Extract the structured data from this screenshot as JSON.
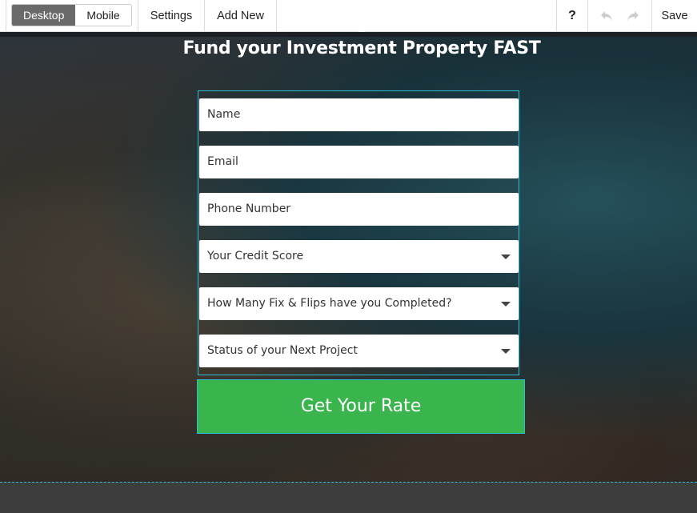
{
  "toolbar": {
    "view_modes": [
      {
        "label": "Desktop",
        "active": true
      },
      {
        "label": "Mobile",
        "active": false
      }
    ],
    "settings_label": "Settings",
    "add_new_label": "Add New",
    "help_label": "?",
    "undo_icon": "undo-icon",
    "redo_icon": "redo-icon",
    "save_label": "Save"
  },
  "page": {
    "headline": "Fund your Investment Property FAST",
    "form": {
      "fields": [
        {
          "type": "text",
          "placeholder": "Name"
        },
        {
          "type": "text",
          "placeholder": "Email"
        },
        {
          "type": "text",
          "placeholder": "Phone Number"
        },
        {
          "type": "select",
          "placeholder": "Your Credit Score"
        },
        {
          "type": "select",
          "placeholder": "How Many Fix & Flips have you Completed?"
        },
        {
          "type": "select",
          "placeholder": "Status of your Next Project"
        }
      ],
      "submit_label": "Get Your Rate"
    },
    "colors": {
      "accent_outline": "#2bc0d8",
      "submit_green": "#3ab54e"
    }
  }
}
